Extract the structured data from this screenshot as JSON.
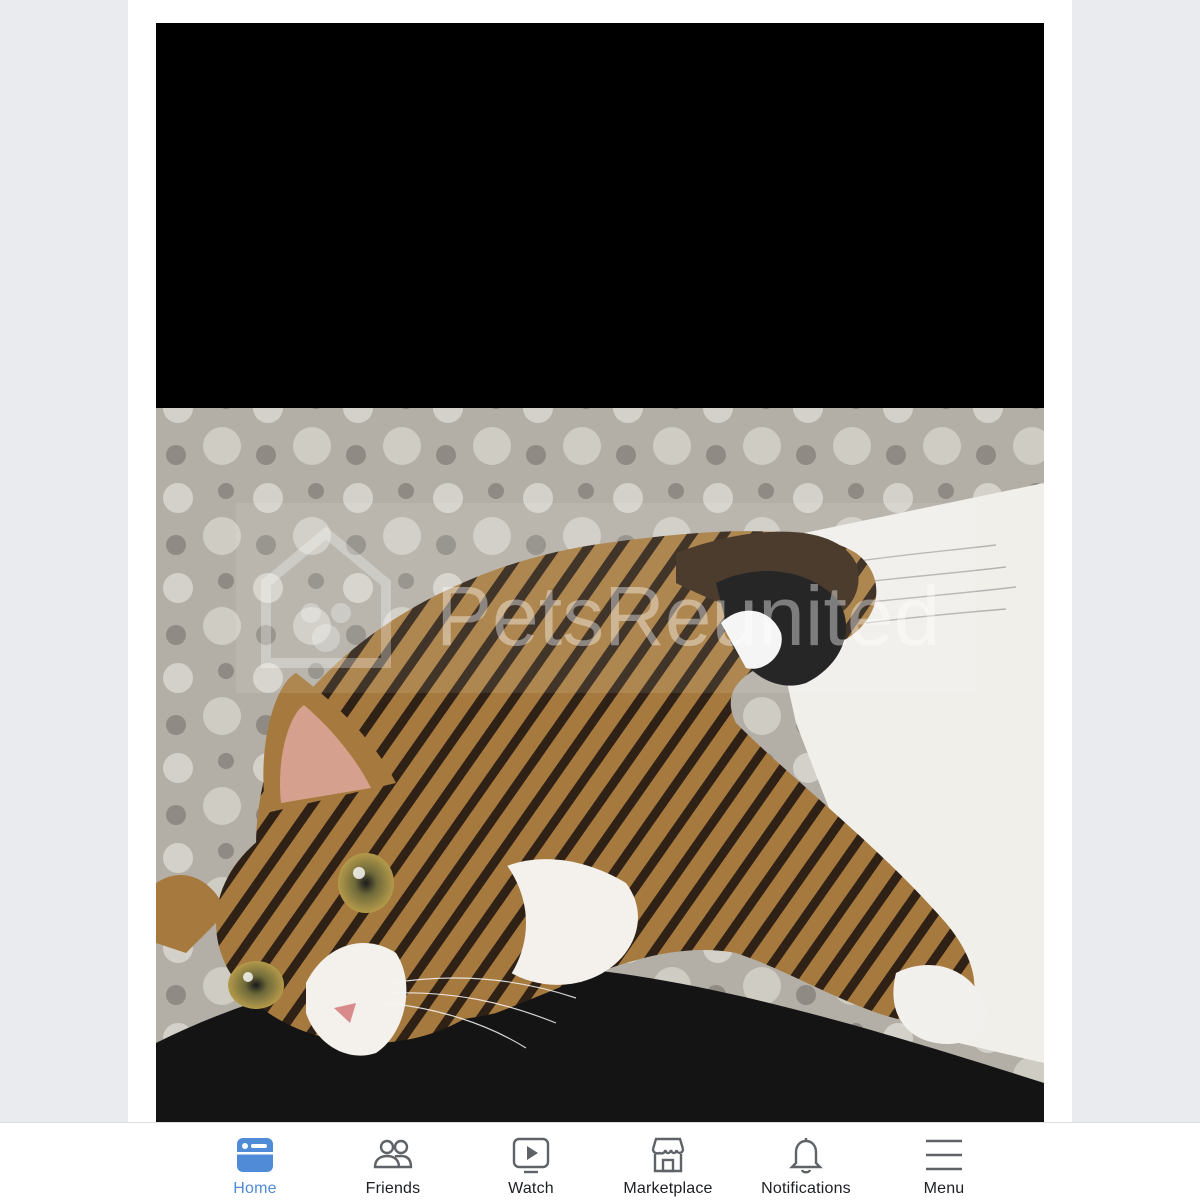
{
  "post": {
    "photo": {
      "subject": "tabby-kitten-on-bed",
      "watermark_text": "PetsReunited",
      "top_region": "black-redacted-area"
    }
  },
  "tabbar": {
    "active_color": "#4f8bd6",
    "tabs": [
      {
        "id": "home",
        "label": "Home",
        "icon": "home-icon",
        "active": true
      },
      {
        "id": "friends",
        "label": "Friends",
        "icon": "friends-icon",
        "active": false
      },
      {
        "id": "watch",
        "label": "Watch",
        "icon": "watch-icon",
        "active": false
      },
      {
        "id": "marketplace",
        "label": "Marketplace",
        "icon": "marketplace-icon",
        "active": false
      },
      {
        "id": "notifications",
        "label": "Notifications",
        "icon": "bell-icon",
        "active": false
      },
      {
        "id": "menu",
        "label": "Menu",
        "icon": "hamburger-icon",
        "active": false
      }
    ]
  }
}
